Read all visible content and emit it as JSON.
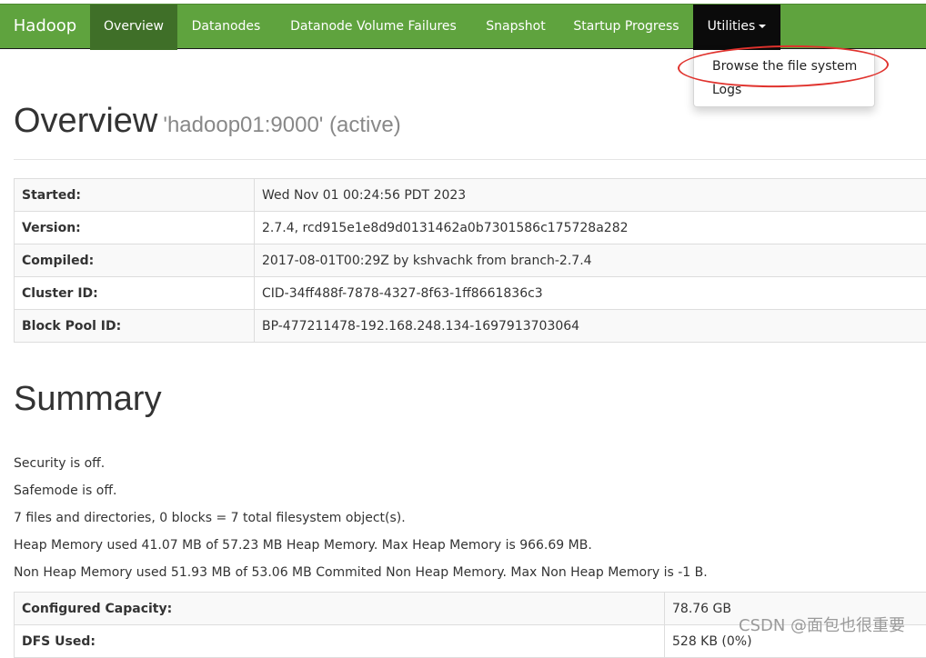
{
  "navbar": {
    "brand": "Hadoop",
    "items": [
      {
        "label": "Overview"
      },
      {
        "label": "Datanodes"
      },
      {
        "label": "Datanode Volume Failures"
      },
      {
        "label": "Snapshot"
      },
      {
        "label": "Startup Progress"
      },
      {
        "label": "Utilities"
      }
    ],
    "colors": {
      "bar": "#5fa33e",
      "active": "#3f6f28",
      "open": "#0b0b0b"
    }
  },
  "dropdown": {
    "items": [
      {
        "label": "Browse the file system"
      },
      {
        "label": "Logs"
      }
    ]
  },
  "overview": {
    "title": "Overview",
    "subtitle": "'hadoop01:9000' (active)",
    "rows": [
      {
        "key": "Started:",
        "value": "Wed Nov 01 00:24:56 PDT 2023"
      },
      {
        "key": "Version:",
        "value": "2.7.4, rcd915e1e8d9d0131462a0b7301586c175728a282"
      },
      {
        "key": "Compiled:",
        "value": "2017-08-01T00:29Z by kshvachk from branch-2.7.4"
      },
      {
        "key": "Cluster ID:",
        "value": "CID-34ff488f-7878-4327-8f63-1ff8661836c3"
      },
      {
        "key": "Block Pool ID:",
        "value": "BP-477211478-192.168.248.134-1697913703064"
      }
    ]
  },
  "summary": {
    "title": "Summary",
    "lines": [
      "Security is off.",
      "Safemode is off.",
      "7 files and directories, 0 blocks = 7 total filesystem object(s).",
      "Heap Memory used 41.07 MB of 57.23 MB Heap Memory. Max Heap Memory is 966.69 MB.",
      "Non Heap Memory used 51.93 MB of 53.06 MB Commited Non Heap Memory. Max Non Heap Memory is -1 B."
    ],
    "rows": [
      {
        "key": "Configured Capacity:",
        "value": "78.76 GB"
      },
      {
        "key": "DFS Used:",
        "value": "528 KB (0%)"
      }
    ]
  },
  "annotation": {
    "color": "#e0322d"
  },
  "watermark": "CSDN @面包也很重要"
}
